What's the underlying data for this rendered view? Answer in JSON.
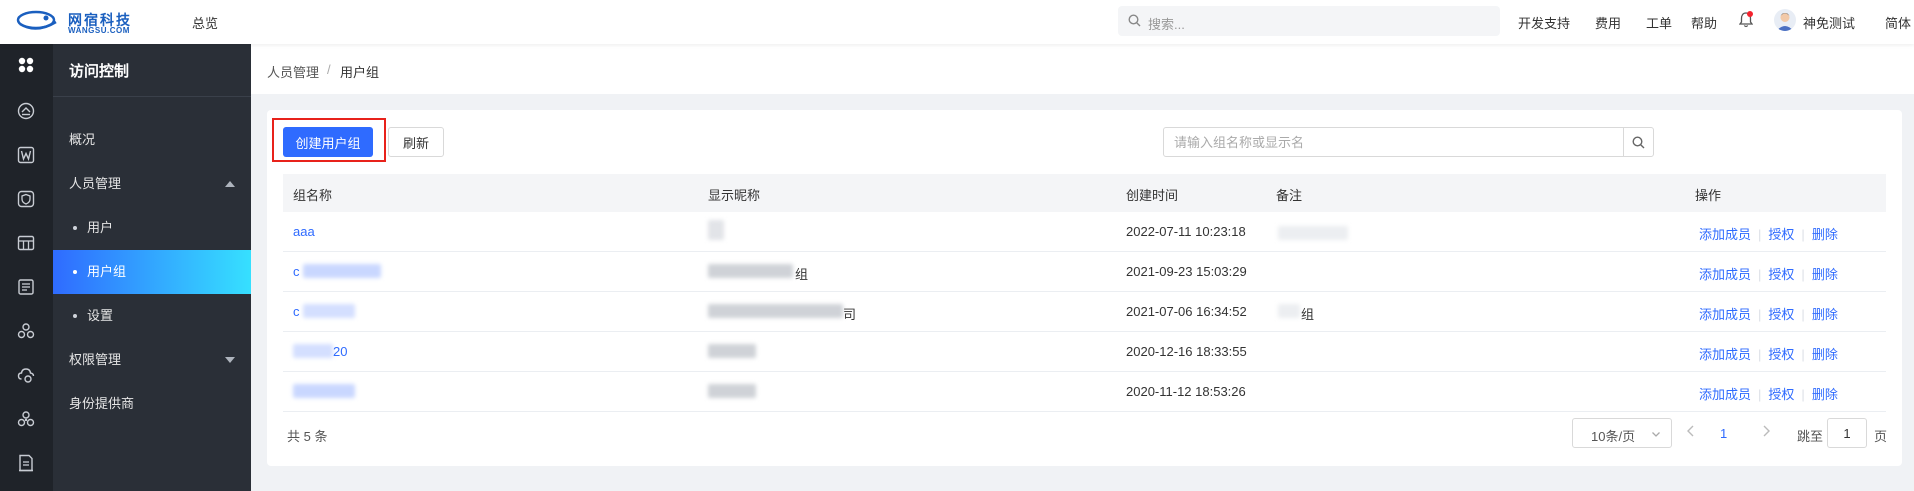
{
  "topbar": {
    "logo_cn": "网宿科技",
    "logo_en": "WANGSU.COM",
    "overview": "总览",
    "search_placeholder": "搜索...",
    "links": [
      "开发支持",
      "费用",
      "工单",
      "帮助"
    ],
    "username": "神免测试",
    "lang": "简体"
  },
  "sidebar": {
    "title": "访问控制",
    "items": [
      {
        "label": "概况"
      },
      {
        "label": "人员管理"
      },
      {
        "label": "用户"
      },
      {
        "label": "用户组"
      },
      {
        "label": "设置"
      },
      {
        "label": "权限管理"
      },
      {
        "label": "身份提供商"
      }
    ]
  },
  "breadcrumb": {
    "parent": "人员管理",
    "sep": "/",
    "current": "用户组"
  },
  "toolbar": {
    "create_label": "创建用户组",
    "refresh_label": "刷新",
    "search_placeholder": "请输入组名称或显示名"
  },
  "table": {
    "headers": [
      "组名称",
      "显示昵称",
      "创建时间",
      "备注",
      "操作"
    ],
    "rows": [
      {
        "name": "aaa",
        "created": "2022-07-11 10:23:18"
      },
      {
        "name": "c",
        "nickname_tail": "组",
        "created": "2021-09-23 15:03:29"
      },
      {
        "name": "c",
        "nickname_tail": "司",
        "created": "2021-07-06 16:34:52",
        "remark_tail": "组"
      },
      {
        "name": "20",
        "created": "2020-12-16 18:33:55"
      },
      {
        "name": "",
        "created": "2020-11-12 18:53:26"
      }
    ],
    "ops": {
      "add_member": "添加成员",
      "authorize": "授权",
      "delete": "删除"
    }
  },
  "pagination": {
    "total": "共 5 条",
    "page_size": "10条/页",
    "current_page": "1",
    "jump_label": "跳至",
    "jump_value": "1",
    "jump_unit": "页"
  },
  "colors": {
    "accent": "#2f6bff",
    "highlight": "#e8221b",
    "sidebar": "#2a2f37",
    "rail": "#1f2329"
  }
}
